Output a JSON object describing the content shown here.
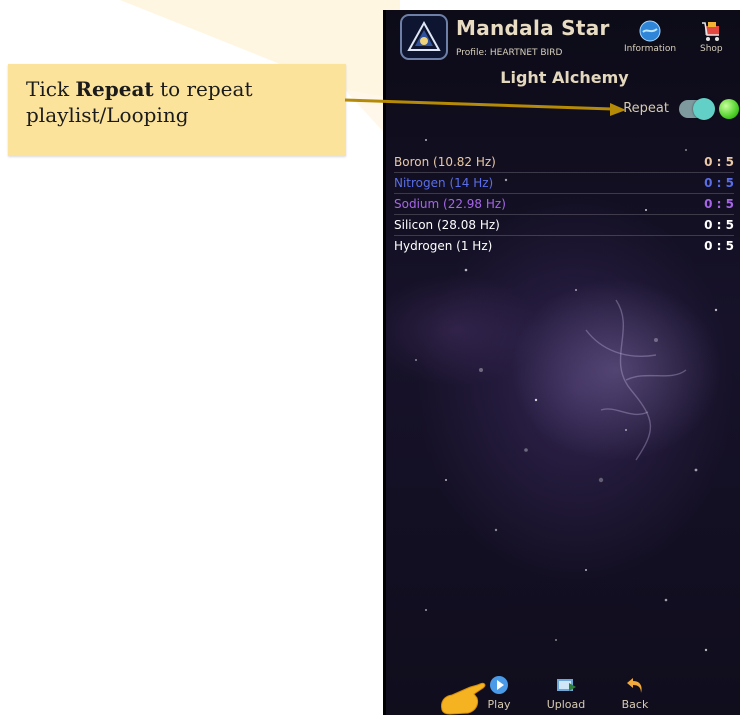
{
  "callout": {
    "prefix": "Tick ",
    "keyword": "Repeat",
    "suffix": " to repeat playlist/Looping"
  },
  "app": {
    "title": "Mandala Star",
    "profile": "Profile: HEARTNET BIRD",
    "nav": [
      {
        "label": "Information",
        "icon": "globe-icon"
      },
      {
        "label": "Shop",
        "icon": "cart-icon"
      }
    ],
    "subtitle": "Light Alchemy",
    "repeat_label": "Repeat",
    "repeat_on": true
  },
  "playlist": [
    {
      "name": "Boron (10.82 Hz)",
      "duration": "0 : 5",
      "color": "#e9c9a8"
    },
    {
      "name": "Nitrogen (14 Hz)",
      "duration": "0 : 5",
      "color": "#5b6ee8"
    },
    {
      "name": "Sodium (22.98 Hz)",
      "duration": "0 : 5",
      "color": "#a566e6"
    },
    {
      "name": "Silicon (28.08 Hz)",
      "duration": "0 : 5",
      "color": "#ffffff"
    },
    {
      "name": "Hydrogen (1 Hz)",
      "duration": "0 : 5",
      "color": "#ffffff"
    }
  ],
  "bottom_bar": [
    {
      "label": "Play",
      "icon": "play-icon"
    },
    {
      "label": "Upload",
      "icon": "upload-icon"
    },
    {
      "label": "Back",
      "icon": "back-arrow-icon"
    }
  ],
  "colors": {
    "callout_bg": "#fbe39c",
    "arrow": "#b58a06",
    "accent_green": "#4fd12b",
    "toggle_knob": "#62d0c6"
  }
}
